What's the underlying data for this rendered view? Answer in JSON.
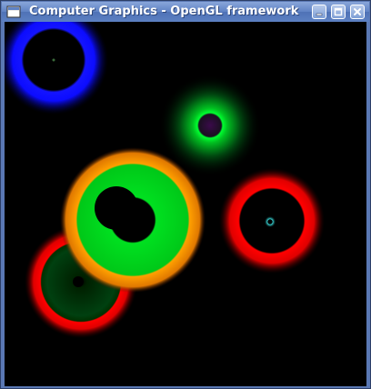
{
  "window": {
    "title": "Computer Graphics - OpenGL framework",
    "icon": "app-window-icon",
    "buttons": {
      "minimize": "minimize-icon",
      "maximize": "maximize-icon",
      "close": "close-icon"
    }
  },
  "colors": {
    "titlebar": "#5f82c4",
    "canvas_background": "#000000",
    "blue": "#1010ff",
    "green": "#00d800",
    "orange": "#ff9a00",
    "red": "#ff0000",
    "purple": "#6a2a7a",
    "cyan": "#3ad6d6"
  }
}
